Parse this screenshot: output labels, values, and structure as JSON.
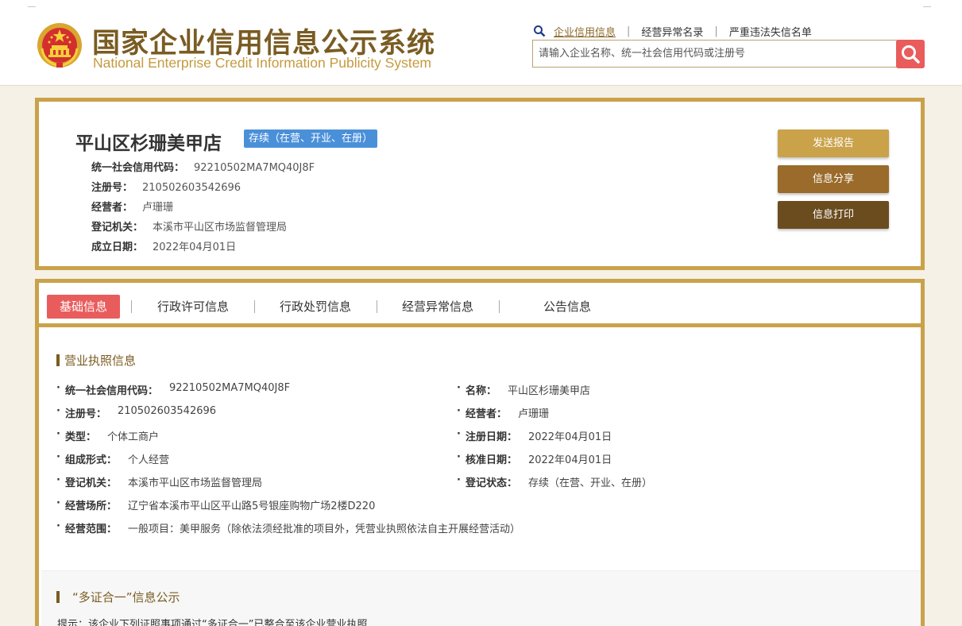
{
  "header": {
    "title_cn": "国家企业信用信息公示系统",
    "title_en": "National Enterprise Credit Information Publicity System",
    "nav": [
      "企业信用信息",
      "经营异常名录",
      "严重违法失信名单"
    ],
    "nav_sep": "|",
    "search_placeholder": "请输入企业名称、统一社会信用代码或注册号"
  },
  "enterprise": {
    "name": "平山区杉珊美甲店",
    "status_tag": "存续（在营、开业、在册）",
    "rows": [
      {
        "label": "统一社会信用代码：",
        "value": "92210502MA7MQ40J8F"
      },
      {
        "label": "注册号：",
        "value": "210502603542696"
      },
      {
        "label": "经营者：",
        "value": "卢珊珊"
      },
      {
        "label": "登记机关：",
        "value": "本溪市平山区市场监督管理局"
      },
      {
        "label": "成立日期：",
        "value": "2022年04月01日"
      }
    ]
  },
  "actions": {
    "send_report": "发送报告",
    "share": "信息分享",
    "print": "信息打印"
  },
  "tabs": [
    "基础信息",
    "行政许可信息",
    "行政处罚信息",
    "经营异常信息",
    "公告信息"
  ],
  "license": {
    "title": "营业执照信息",
    "bullet": "·",
    "left": [
      {
        "label": "统一社会信用代码：",
        "value": "92210502MA7MQ40J8F"
      },
      {
        "label": "注册号：",
        "value": "210502603542696"
      },
      {
        "label": "类型：",
        "value": "个体工商户"
      },
      {
        "label": "组成形式：",
        "value": "个人经营"
      },
      {
        "label": "登记机关：",
        "value": "本溪市平山区市场监督管理局"
      },
      {
        "label": "经营场所：",
        "value": "辽宁省本溪市平山区平山路5号银座购物广场2楼D220"
      },
      {
        "label": "经营范围：",
        "value": "一般项目：美甲服务（除依法须经批准的项目外，凭营业执照依法自主开展经营活动）"
      }
    ],
    "right": [
      {
        "label": "名称：",
        "value": "平山区杉珊美甲店"
      },
      {
        "label": "经营者：",
        "value": "卢珊珊"
      },
      {
        "label": "注册日期：",
        "value": "2022年04月01日"
      },
      {
        "label": "核准日期：",
        "value": "2022年04月01日"
      },
      {
        "label": "登记状态：",
        "value": "存续（在营、开业、在册）"
      }
    ]
  },
  "multi_cert": {
    "title": "“多证合一”信息公示",
    "hint": "提示：该企业下列证照事项通过“多证合一”已整合至该企业营业执照"
  },
  "colors": {
    "gold_border": "#c9a24a",
    "brand_brown": "#7a5c22",
    "accent_red": "#e95c5c",
    "status_blue": "#4a90d9",
    "btn_send": "#c9a24a",
    "btn_share": "#9a6b2a",
    "btn_print": "#6b4c1f"
  }
}
